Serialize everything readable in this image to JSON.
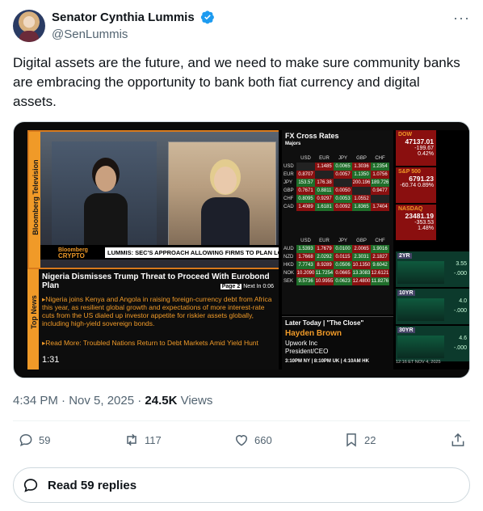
{
  "author": {
    "name": "Senator Cynthia Lummis",
    "handle": "@SenLummis"
  },
  "tweet": {
    "text": "Digital assets are the future, and we need to make sure community banks are embracing the opportunity to bank both fiat currency and digital assets."
  },
  "video": {
    "channel_label": "Bloomberg Television",
    "crypto_logo_top": "Bloomberg",
    "crypto_logo_bottom": "CRYPTO",
    "lower_third": "LUMMIS: SEC'S APPROACH ALLOWING FIRMS TO PLAN LONG-TERM",
    "news_tab": "Top News",
    "news_title": "Nigeria Dismisses Trump Threat to Proceed With Eurobond Plan",
    "page_label": "Page 2",
    "next_label": "Next In 0:06",
    "bullet1": "▸Nigeria joins Kenya and Angola in raising foreign-currency debt from Africa this year, as resilient global growth and expectations of more interest-rate cuts from the US dialed up investor appetite for riskier assets globally, including high-yield sovereign bonds.",
    "bullet2": "▸Read More: Troubled Nations Return to Debt Markets Amid Yield Hunt",
    "timestamp": "1:31",
    "fx_title": "FX Cross Rates",
    "fx_sub": "Majors",
    "fx_headers": [
      "USD",
      "EUR",
      "JPY",
      "GBP",
      "CHF"
    ],
    "fx_rows1": [
      {
        "label": "USD",
        "cells": [
          "",
          "1.1485",
          "0.0065",
          "1.3036",
          "1.2354"
        ]
      },
      {
        "label": "EUR",
        "cells": [
          "0.8707",
          "",
          "0.0057",
          "1.1350",
          "1.0756"
        ]
      },
      {
        "label": "JPY",
        "cells": [
          "153.57",
          "176.38",
          "",
          "200.196",
          "189.726"
        ]
      },
      {
        "label": "GBP",
        "cells": [
          "0.7671",
          "0.8811",
          "0.0050",
          "",
          "0.9477"
        ]
      },
      {
        "label": "CHF",
        "cells": [
          "0.8095",
          "0.9297",
          "0.0053",
          "1.0552",
          ""
        ]
      },
      {
        "label": "CAD",
        "cells": [
          "1.4089",
          "1.6181",
          "0.0092",
          "1.8365",
          "1.7404"
        ]
      }
    ],
    "fx_rows2": [
      {
        "label": "AUD",
        "cells": [
          "1.5393",
          "1.7679",
          "0.0100",
          "2.0065",
          "1.9016"
        ]
      },
      {
        "label": "NZD",
        "cells": [
          "1.7668",
          "2.0292",
          "0.0115",
          "2.3031",
          "2.1827"
        ]
      },
      {
        "label": "HKD",
        "cells": [
          "7.7743",
          "8.9289",
          "0.0506",
          "10.1350",
          "9.6042"
        ]
      },
      {
        "label": "NOK",
        "cells": [
          "10.2090",
          "11.7254",
          "0.0665",
          "13.3083",
          "12.6121"
        ]
      },
      {
        "label": "SEK",
        "cells": [
          "9.5736",
          "10.9955",
          "0.0623",
          "12.4800",
          "11.8276"
        ]
      }
    ],
    "later_head": "Later Today | \"The Close\"",
    "later_name": "Hayden Brown",
    "later_company": "Upwork Inc",
    "later_role": "President/CEO",
    "later_times": "3:10PM NY | 8:10PM UK | 4:10AM HK",
    "indices": [
      {
        "name": "DOW",
        "value": "47137.01",
        "change": "-199.67 0.42%"
      },
      {
        "name": "S&P 500",
        "value": "6791.23",
        "change": "-60.74 0.89%"
      },
      {
        "name": "NASDAQ",
        "value": "23481.19",
        "change": "-353.53 1.48%"
      }
    ],
    "yields": [
      {
        "name": "2YR",
        "value": "3.55",
        "change": "-.000"
      },
      {
        "name": "10YR",
        "value": "4.0",
        "change": "-.000"
      },
      {
        "name": "30YR",
        "value": "4.6",
        "change": "-.000"
      }
    ],
    "ticker_footer": "12:16 ET   NOV 4, 2025"
  },
  "meta": {
    "time": "4:34 PM · Nov 5, 2025 · ",
    "views_count": "24.5K",
    "views_label": " Views"
  },
  "actions": {
    "replies": "59",
    "reposts": "117",
    "likes": "660",
    "bookmarks": "22"
  },
  "read_replies": "Read 59 replies",
  "colors": {
    "verified": "#1d9bf0",
    "bloomberg_orange": "#f09a28"
  }
}
